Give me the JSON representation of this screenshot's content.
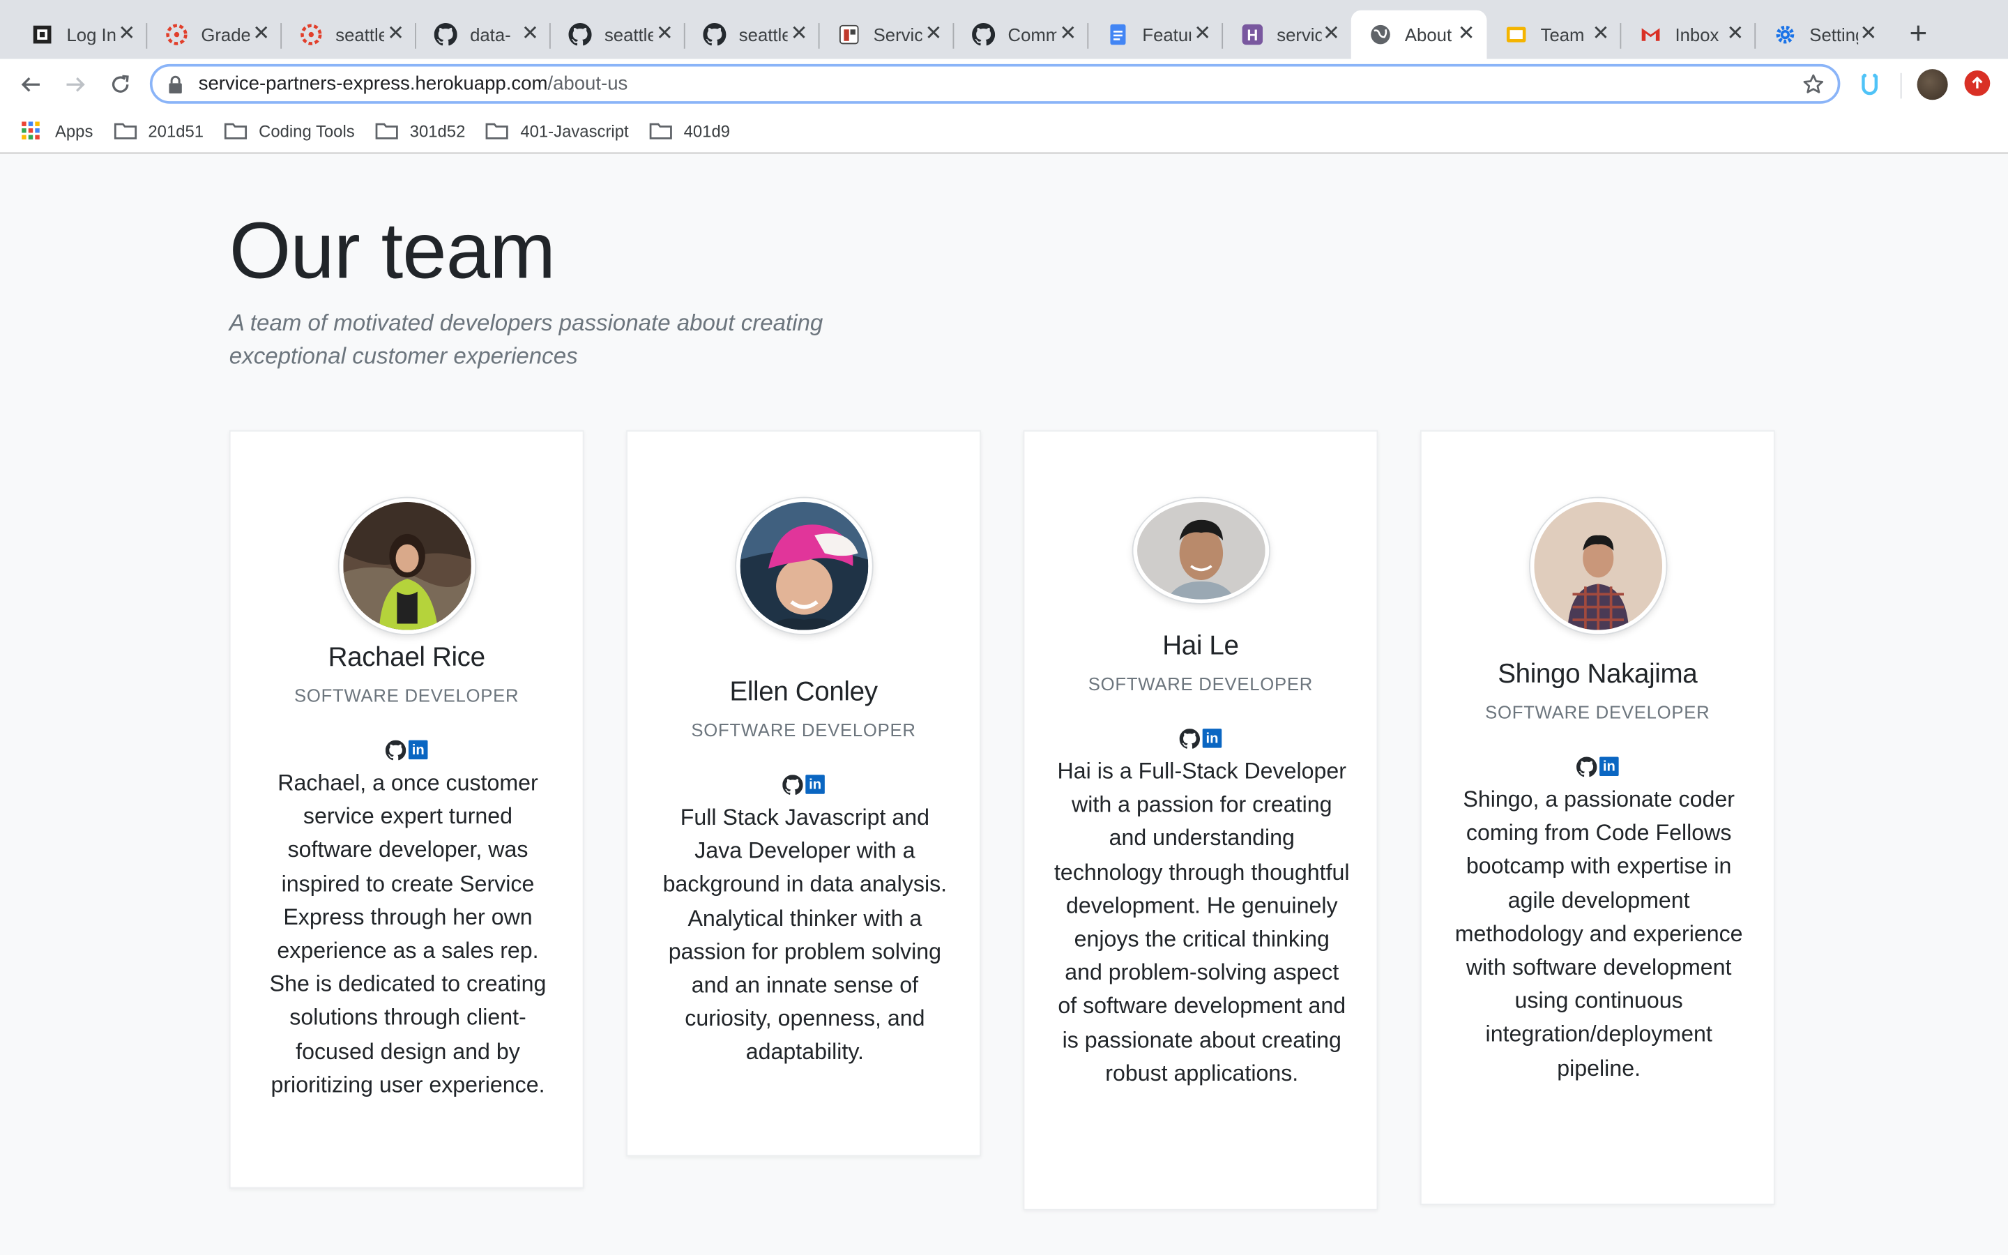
{
  "browser": {
    "tabs": [
      {
        "title": "Log In",
        "icon": "code-fellows-icon"
      },
      {
        "title": "Grades",
        "icon": "canvas-icon"
      },
      {
        "title": "seattle",
        "icon": "canvas-icon"
      },
      {
        "title": "data-",
        "icon": "github-icon"
      },
      {
        "title": "seattle",
        "icon": "github-icon"
      },
      {
        "title": "seattle",
        "icon": "github-icon"
      },
      {
        "title": "Service",
        "icon": "app-icon"
      },
      {
        "title": "Comm",
        "icon": "github-icon"
      },
      {
        "title": "Features",
        "icon": "google-docs-icon"
      },
      {
        "title": "service",
        "icon": "heroku-icon"
      },
      {
        "title": "About",
        "icon": "globe-icon"
      },
      {
        "title": "Team",
        "icon": "google-slides-icon"
      },
      {
        "title": "Inbox",
        "icon": "gmail-icon"
      },
      {
        "title": "Settings",
        "icon": "gear-icon"
      }
    ],
    "url_host": "service-partners-express.herokuapp.com",
    "url_path": "/about-us",
    "bookmarks": [
      {
        "label": "Apps",
        "icon": "apps-grid-icon"
      },
      {
        "label": "201d51",
        "icon": "folder-icon"
      },
      {
        "label": "Coding Tools",
        "icon": "folder-icon"
      },
      {
        "label": "301d52",
        "icon": "folder-icon"
      },
      {
        "label": "401-Javascript",
        "icon": "folder-icon"
      },
      {
        "label": "401d9",
        "icon": "folder-icon"
      }
    ]
  },
  "page": {
    "title": "Our team",
    "subtitle": "A team of motivated developers passionate about creating exceptional customer experiences",
    "members": [
      {
        "name": "Rachael Rice",
        "role": "SOFTWARE DEVELOPER",
        "bio": "Rachael, a once customer service expert turned software developer, was inspired to create Service Express through her own experience as a sales rep. She is dedicated to creating solutions through client-focused design and by prioritizing user experience."
      },
      {
        "name": "Ellen Conley",
        "role": "SOFTWARE DEVELOPER",
        "bio": "Full Stack Javascript and Java Developer with a background in data analysis. Analytical thinker with a passion for problem solving and an innate sense of curiosity, openness, and adaptability."
      },
      {
        "name": "Hai Le",
        "role": "SOFTWARE DEVELOPER",
        "bio": "Hai is a Full-Stack Developer with a passion for creating and understanding technology through thoughtful development. He genuinely enjoys the critical thinking and problem-solving aspect of software development and is passionate about creating robust applications."
      },
      {
        "name": "Shingo Nakajima",
        "role": "SOFTWARE DEVELOPER",
        "bio": "Shingo, a passionate coder coming from Code Fellows bootcamp with expertise in agile development methodology and experience with software development using continuous integration/deployment pipeline."
      }
    ],
    "social": {
      "github": "github-icon",
      "linkedin": "in"
    }
  }
}
